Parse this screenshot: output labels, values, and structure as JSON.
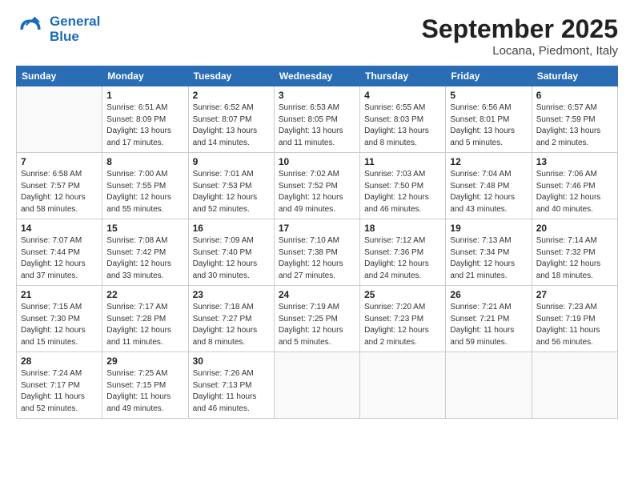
{
  "header": {
    "logo_line1": "General",
    "logo_line2": "Blue",
    "month": "September 2025",
    "location": "Locana, Piedmont, Italy"
  },
  "days_of_week": [
    "Sunday",
    "Monday",
    "Tuesday",
    "Wednesday",
    "Thursday",
    "Friday",
    "Saturday"
  ],
  "weeks": [
    [
      {
        "day": "",
        "info": ""
      },
      {
        "day": "1",
        "info": "Sunrise: 6:51 AM\nSunset: 8:09 PM\nDaylight: 13 hours\nand 17 minutes."
      },
      {
        "day": "2",
        "info": "Sunrise: 6:52 AM\nSunset: 8:07 PM\nDaylight: 13 hours\nand 14 minutes."
      },
      {
        "day": "3",
        "info": "Sunrise: 6:53 AM\nSunset: 8:05 PM\nDaylight: 13 hours\nand 11 minutes."
      },
      {
        "day": "4",
        "info": "Sunrise: 6:55 AM\nSunset: 8:03 PM\nDaylight: 13 hours\nand 8 minutes."
      },
      {
        "day": "5",
        "info": "Sunrise: 6:56 AM\nSunset: 8:01 PM\nDaylight: 13 hours\nand 5 minutes."
      },
      {
        "day": "6",
        "info": "Sunrise: 6:57 AM\nSunset: 7:59 PM\nDaylight: 13 hours\nand 2 minutes."
      }
    ],
    [
      {
        "day": "7",
        "info": "Sunrise: 6:58 AM\nSunset: 7:57 PM\nDaylight: 12 hours\nand 58 minutes."
      },
      {
        "day": "8",
        "info": "Sunrise: 7:00 AM\nSunset: 7:55 PM\nDaylight: 12 hours\nand 55 minutes."
      },
      {
        "day": "9",
        "info": "Sunrise: 7:01 AM\nSunset: 7:53 PM\nDaylight: 12 hours\nand 52 minutes."
      },
      {
        "day": "10",
        "info": "Sunrise: 7:02 AM\nSunset: 7:52 PM\nDaylight: 12 hours\nand 49 minutes."
      },
      {
        "day": "11",
        "info": "Sunrise: 7:03 AM\nSunset: 7:50 PM\nDaylight: 12 hours\nand 46 minutes."
      },
      {
        "day": "12",
        "info": "Sunrise: 7:04 AM\nSunset: 7:48 PM\nDaylight: 12 hours\nand 43 minutes."
      },
      {
        "day": "13",
        "info": "Sunrise: 7:06 AM\nSunset: 7:46 PM\nDaylight: 12 hours\nand 40 minutes."
      }
    ],
    [
      {
        "day": "14",
        "info": "Sunrise: 7:07 AM\nSunset: 7:44 PM\nDaylight: 12 hours\nand 37 minutes."
      },
      {
        "day": "15",
        "info": "Sunrise: 7:08 AM\nSunset: 7:42 PM\nDaylight: 12 hours\nand 33 minutes."
      },
      {
        "day": "16",
        "info": "Sunrise: 7:09 AM\nSunset: 7:40 PM\nDaylight: 12 hours\nand 30 minutes."
      },
      {
        "day": "17",
        "info": "Sunrise: 7:10 AM\nSunset: 7:38 PM\nDaylight: 12 hours\nand 27 minutes."
      },
      {
        "day": "18",
        "info": "Sunrise: 7:12 AM\nSunset: 7:36 PM\nDaylight: 12 hours\nand 24 minutes."
      },
      {
        "day": "19",
        "info": "Sunrise: 7:13 AM\nSunset: 7:34 PM\nDaylight: 12 hours\nand 21 minutes."
      },
      {
        "day": "20",
        "info": "Sunrise: 7:14 AM\nSunset: 7:32 PM\nDaylight: 12 hours\nand 18 minutes."
      }
    ],
    [
      {
        "day": "21",
        "info": "Sunrise: 7:15 AM\nSunset: 7:30 PM\nDaylight: 12 hours\nand 15 minutes."
      },
      {
        "day": "22",
        "info": "Sunrise: 7:17 AM\nSunset: 7:28 PM\nDaylight: 12 hours\nand 11 minutes."
      },
      {
        "day": "23",
        "info": "Sunrise: 7:18 AM\nSunset: 7:27 PM\nDaylight: 12 hours\nand 8 minutes."
      },
      {
        "day": "24",
        "info": "Sunrise: 7:19 AM\nSunset: 7:25 PM\nDaylight: 12 hours\nand 5 minutes."
      },
      {
        "day": "25",
        "info": "Sunrise: 7:20 AM\nSunset: 7:23 PM\nDaylight: 12 hours\nand 2 minutes."
      },
      {
        "day": "26",
        "info": "Sunrise: 7:21 AM\nSunset: 7:21 PM\nDaylight: 11 hours\nand 59 minutes."
      },
      {
        "day": "27",
        "info": "Sunrise: 7:23 AM\nSunset: 7:19 PM\nDaylight: 11 hours\nand 56 minutes."
      }
    ],
    [
      {
        "day": "28",
        "info": "Sunrise: 7:24 AM\nSunset: 7:17 PM\nDaylight: 11 hours\nand 52 minutes."
      },
      {
        "day": "29",
        "info": "Sunrise: 7:25 AM\nSunset: 7:15 PM\nDaylight: 11 hours\nand 49 minutes."
      },
      {
        "day": "30",
        "info": "Sunrise: 7:26 AM\nSunset: 7:13 PM\nDaylight: 11 hours\nand 46 minutes."
      },
      {
        "day": "",
        "info": ""
      },
      {
        "day": "",
        "info": ""
      },
      {
        "day": "",
        "info": ""
      },
      {
        "day": "",
        "info": ""
      }
    ]
  ]
}
